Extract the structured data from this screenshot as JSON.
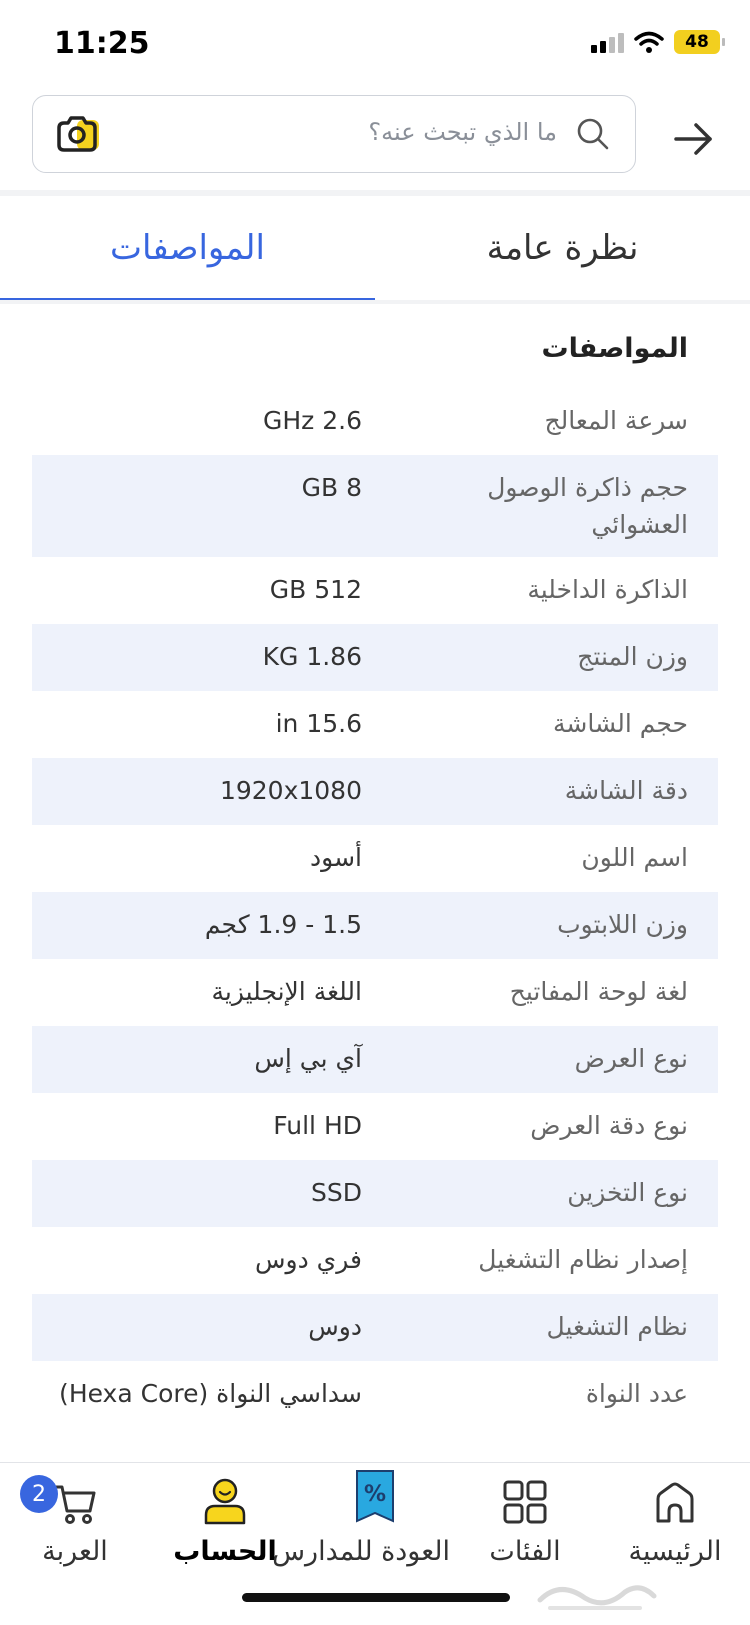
{
  "status_bar": {
    "time": "11:25",
    "battery": "48"
  },
  "search": {
    "placeholder": "ما الذي تبحث عنه؟"
  },
  "tabs": [
    {
      "label": "نظرة عامة",
      "active": false
    },
    {
      "label": "المواصفات",
      "active": true
    }
  ],
  "specs": {
    "title": "المواصفات",
    "rows": [
      {
        "key": "سرعة المعالج",
        "value": "2.6 GHz"
      },
      {
        "key": "حجم ذاكرة الوصول العشوائي",
        "value": "8 GB"
      },
      {
        "key": "الذاكرة الداخلية",
        "value": "512 GB"
      },
      {
        "key": "وزن المنتج",
        "value": "1.86 KG"
      },
      {
        "key": "حجم الشاشة",
        "value": "15.6 in"
      },
      {
        "key": "دقة الشاشة",
        "value": "1920x1080"
      },
      {
        "key": "اسم اللون",
        "value": "أسود"
      },
      {
        "key": "وزن اللابتوب",
        "value": "1.5 - 1.9 كجم"
      },
      {
        "key": "لغة لوحة المفاتيح",
        "value": "اللغة الإنجليزية"
      },
      {
        "key": "نوع العرض",
        "value": "آي بي إس"
      },
      {
        "key": "نوع دقة العرض",
        "value": "Full HD"
      },
      {
        "key": "نوع التخزين",
        "value": "SSD"
      },
      {
        "key": "إصدار نظام التشغيل",
        "value": "فري دوس"
      },
      {
        "key": "نظام التشغيل",
        "value": "دوس"
      },
      {
        "key": "عدد النواة",
        "value": "سداسي النواة (Hexa Core)"
      }
    ]
  },
  "bottom_nav": {
    "items": [
      {
        "label": "الرئيسية",
        "icon": "home-icon"
      },
      {
        "label": "الفئات",
        "icon": "grid-icon"
      },
      {
        "label": "العودة للمدارس",
        "icon": "discount-tag-icon"
      },
      {
        "label": "الحساب",
        "icon": "account-icon"
      },
      {
        "label": "العربة",
        "icon": "cart-icon",
        "badge": "2"
      }
    ]
  },
  "colors": {
    "accent": "#3866df",
    "shaded_row": "#eef2fb",
    "battery": "#f2cf1f",
    "account": "#f7d51d",
    "tag": "#29a8e0"
  }
}
